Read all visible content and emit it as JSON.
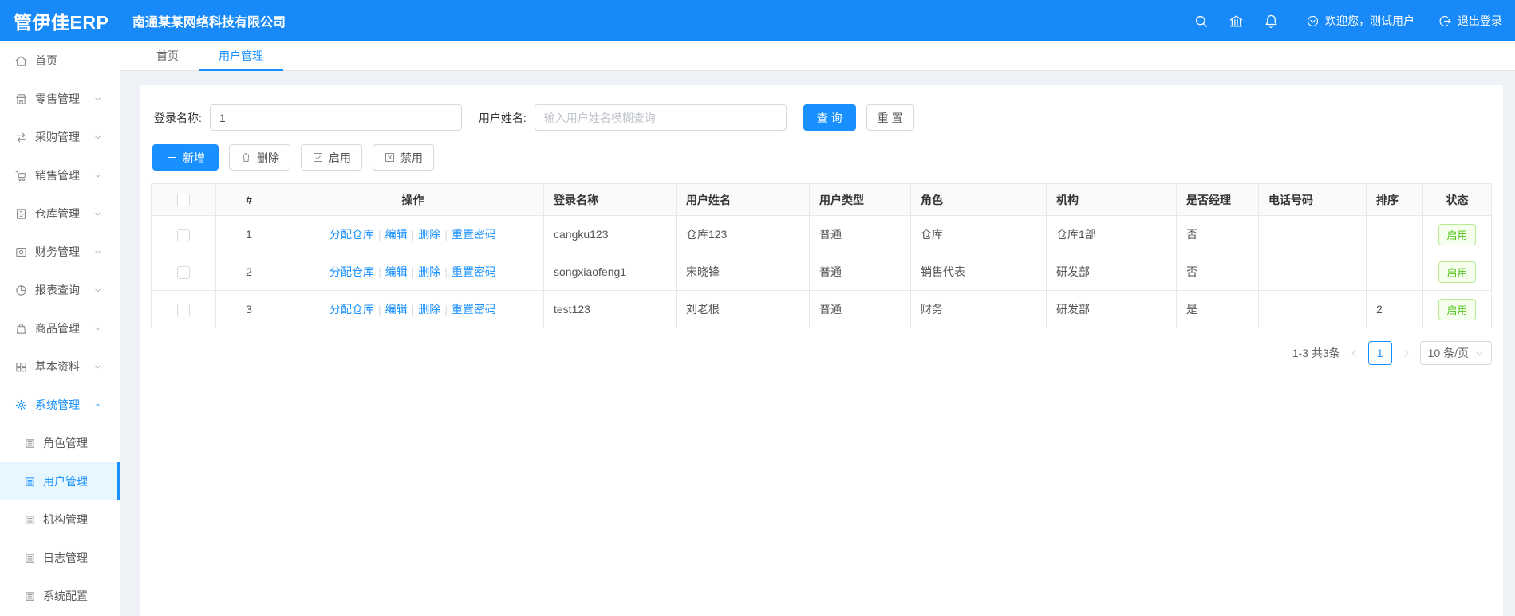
{
  "header": {
    "logo": "管伊佳ERP",
    "company": "南通某某网络科技有限公司",
    "welcome": "欢迎您，测试用户",
    "logout": "退出登录",
    "icons": [
      "search-icon",
      "bank-icon",
      "bell-icon",
      "circle-chevron-down-icon",
      "logout-icon"
    ]
  },
  "sidebar": {
    "items": [
      {
        "label": "首页",
        "icon": "home-icon"
      },
      {
        "label": "零售管理",
        "icon": "shop-icon"
      },
      {
        "label": "采购管理",
        "icon": "swap-icon"
      },
      {
        "label": "销售管理",
        "icon": "cart-icon"
      },
      {
        "label": "仓库管理",
        "icon": "warehouse-icon"
      },
      {
        "label": "财务管理",
        "icon": "finance-icon"
      },
      {
        "label": "报表查询",
        "icon": "pie-chart-icon"
      },
      {
        "label": "商品管理",
        "icon": "bag-icon"
      },
      {
        "label": "基本资料",
        "icon": "grid-icon"
      },
      {
        "label": "系统管理",
        "icon": "gear-icon"
      }
    ],
    "sub_items": [
      {
        "label": "角色管理"
      },
      {
        "label": "用户管理"
      },
      {
        "label": "机构管理"
      },
      {
        "label": "日志管理"
      },
      {
        "label": "系统配置"
      }
    ]
  },
  "tabs": [
    {
      "label": "首页"
    },
    {
      "label": "用户管理"
    }
  ],
  "search": {
    "login_label": "登录名称:",
    "login_value": "1",
    "name_label": "用户姓名:",
    "name_placeholder": "输入用户姓名模糊查询",
    "query_button": "查 询",
    "reset_button": "重 置"
  },
  "toolbar": {
    "add": "新增",
    "delete": "删除",
    "enable": "启用",
    "disable": "禁用"
  },
  "table": {
    "headers": [
      "#",
      "操作",
      "登录名称",
      "用户姓名",
      "用户类型",
      "角色",
      "机构",
      "是否经理",
      "电话号码",
      "排序",
      "状态"
    ],
    "action_links": [
      "分配仓库",
      "编辑",
      "删除",
      "重置密码"
    ],
    "rows": [
      {
        "index": "1",
        "login": "cangku123",
        "name": "仓库123",
        "type": "普通",
        "role": "仓库",
        "org": "仓库1部",
        "manager": "否",
        "phone": "",
        "sort": "",
        "status": "启用"
      },
      {
        "index": "2",
        "login": "songxiaofeng1",
        "name": "宋晓锋",
        "type": "普通",
        "role": "销售代表",
        "org": "研发部",
        "manager": "否",
        "phone": "",
        "sort": "",
        "status": "启用"
      },
      {
        "index": "3",
        "login": "test123",
        "name": "刘老根",
        "type": "普通",
        "role": "财务",
        "org": "研发部",
        "manager": "是",
        "phone": "",
        "sort": "2",
        "status": "启用"
      }
    ]
  },
  "pagination": {
    "total": "1-3 共3条",
    "page": "1",
    "page_size": "10 条/页"
  },
  "colors": {
    "primary": "#1890ff",
    "topbar": "#1789f8",
    "success_text": "#52c41a",
    "success_bg": "#f6ffed",
    "success_border": "#b7eb8f",
    "active_menu_bg": "#e6f7ff"
  }
}
